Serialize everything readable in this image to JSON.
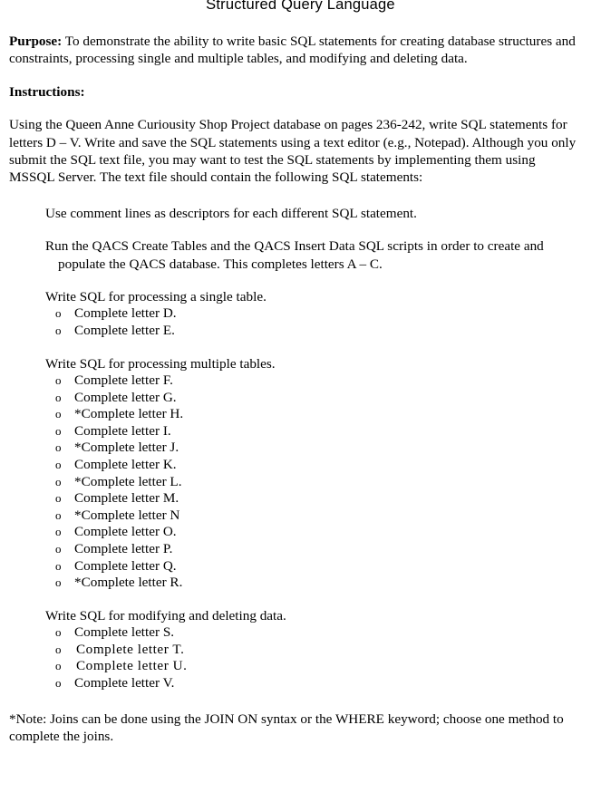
{
  "document": {
    "title": "Structured Query Language",
    "purpose": {
      "label": "Purpose:",
      "text": " To demonstrate the ability to write basic SQL statements for creating database structures and constraints, processing single and multiple tables, and modifying and deleting data."
    },
    "instructions_heading": "Instructions:",
    "instructions_body": "Using the Queen Anne Curiousity Shop Project database on pages 236-242, write SQL statements for letters D – V. Write and save the SQL statements using a text editor (e.g., Notepad).  Although you only submit the SQL text file, you may want to test the SQL statements by implementing them using MSSQL Server.  The text file should contain the following SQL statements:",
    "steps": [
      {
        "id": "comment-lines",
        "text": "Use comment lines as descriptors for each different SQL statement.",
        "bullets": []
      },
      {
        "id": "qacs-scripts",
        "text": "Run the QACS Create Tables and the QACS Insert Data SQL scripts in order to create and populate the QACS database.  This completes letters A – C.",
        "bullets": []
      },
      {
        "id": "single-table",
        "text": "Write SQL for processing a single table.",
        "bullets": [
          {
            "marker": "o",
            "label": "Complete letter D.",
            "spaced": false
          },
          {
            "marker": "o",
            "label": "Complete letter E.",
            "spaced": false
          }
        ]
      },
      {
        "id": "multiple-tables",
        "text": "Write SQL for processing multiple tables.",
        "bullets": [
          {
            "marker": "o",
            "label": "Complete letter F.",
            "spaced": false
          },
          {
            "marker": "o",
            "label": "Complete letter G.",
            "spaced": false
          },
          {
            "marker": "o",
            "label": "*Complete letter H.",
            "spaced": false
          },
          {
            "marker": "o",
            "label": "Complete letter I.",
            "spaced": false
          },
          {
            "marker": "o",
            "label": "*Complete letter J.",
            "spaced": false
          },
          {
            "marker": "o",
            "label": "Complete letter K.",
            "spaced": false
          },
          {
            "marker": "o",
            "label": "*Complete letter L.",
            "spaced": false
          },
          {
            "marker": "o",
            "label": "Complete letter M.",
            "spaced": false
          },
          {
            "marker": "o",
            "label": "*Complete letter N",
            "spaced": false
          },
          {
            "marker": "o",
            "label": "Complete letter O.",
            "spaced": false
          },
          {
            "marker": "o",
            "label": "Complete letter P.",
            "spaced": false
          },
          {
            "marker": "o",
            "label": "Complete letter Q.",
            "spaced": false
          },
          {
            "marker": "o",
            "label": "*Complete letter R.",
            "spaced": false
          }
        ]
      },
      {
        "id": "modify-delete",
        "text": "Write SQL for modifying and deleting data.",
        "bullets": [
          {
            "marker": "o",
            "label": "Complete letter S.",
            "spaced": false
          },
          {
            "marker": "o",
            "label": "Complete letter T.",
            "spaced": true
          },
          {
            "marker": "o",
            "label": "Complete letter U.",
            "spaced": true
          },
          {
            "marker": "o",
            "label": "Complete letter V.",
            "spaced": false
          }
        ]
      }
    ],
    "footnote": "*Note: Joins can be done using the JOIN ON syntax or the WHERE keyword; choose one method to complete the joins."
  }
}
